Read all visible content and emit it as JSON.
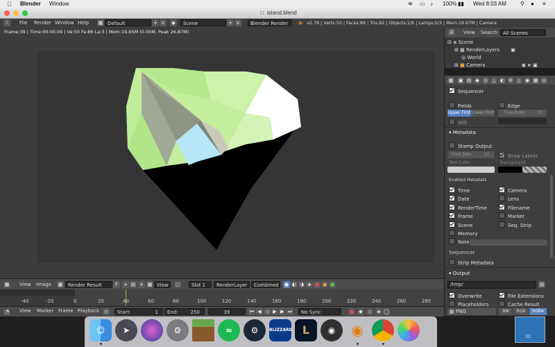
{
  "mac_menubar": {
    "app_name": "Blender",
    "window_menu": "Window",
    "battery": "100%",
    "datetime": "Wed 8:03 AM"
  },
  "window": {
    "title": "island.blend"
  },
  "blender_header": {
    "menus": [
      "File",
      "Render",
      "Window",
      "Help"
    ],
    "screen_layout": "Default",
    "scene": "Scene",
    "render_engine": "Blender Render",
    "stats": "v2.78 | Verts:50 | Faces:86 | Tris:92 | Objects:1/6 | Lamps:0/3 | Mem:19.67M | Camera"
  },
  "viewport": {
    "render_info": "Frame:39 | Time:00:00.09 | Ve:50 Fa:86 La:3 | Mem:19.65M (0.00M, Peak 26.87M)"
  },
  "image_editor_header": {
    "menus": [
      "View",
      "Image"
    ],
    "image_name": "Render Result",
    "image_fake_flag": "F",
    "view_menu": "View",
    "slot": "Slot 1",
    "render_layer": "RenderLayer",
    "pass": "Combined"
  },
  "timeline": {
    "ticks": [
      "-40",
      "-20",
      "0",
      "20",
      "40",
      "60",
      "80",
      "100",
      "120",
      "140",
      "160",
      "180",
      "200",
      "220",
      "240",
      "260"
    ],
    "last_tick": "280",
    "menus": [
      "View",
      "Marker",
      "Frame",
      "Playback"
    ],
    "start_label": "Start:",
    "start_value": "1",
    "end_label": "End:",
    "end_value": "250",
    "current_frame": "39",
    "sync_mode": "No Sync"
  },
  "outliner": {
    "header": {
      "view": "View",
      "search": "Search",
      "filter": "All Scenes"
    },
    "items": [
      "Scene",
      "RenderLayers",
      "World",
      "Camera"
    ]
  },
  "properties": {
    "sequencer_label": "Sequencer",
    "fields_label": "Fields",
    "edge_label": "Edge",
    "field_order": [
      "Upper First",
      "Lower First"
    ],
    "threshold_label": "Threshold:",
    "threshold_value": "10",
    "still_label": "Still",
    "metadata_header": "Metadata",
    "stamp_output_label": "Stamp Output",
    "font_size_label": "Font Size:",
    "font_size_value": "12",
    "draw_labels_label": "Draw Labels",
    "text_color_label": "Text Color:",
    "background_label": "Background:",
    "enabled_metadata_label": "Enabled Metadata",
    "metadata_left": [
      "Time",
      "Date",
      "RenderTime",
      "Frame",
      "Scene",
      "Memory",
      "Note"
    ],
    "metadata_left_checked": [
      true,
      true,
      true,
      true,
      true,
      false,
      false
    ],
    "metadata_right": [
      "Camera",
      "Lens",
      "Filename",
      "Marker",
      "Seq. Strip"
    ],
    "metadata_right_checked": [
      true,
      false,
      true,
      false,
      false
    ],
    "sequencer_sub_label": "Sequencer",
    "strip_metadata_label": "Strip Metadata",
    "output_header": "Output",
    "output_path": "/tmp/",
    "overwrite_label": "Overwrite",
    "file_extensions_label": "File Extensions",
    "placeholders_label": "Placeholders",
    "cache_result_label": "Cache Result",
    "file_format": "PNG",
    "color_modes": [
      "BW",
      "RGB",
      "RGBA"
    ]
  },
  "desktop": {
    "thumb_label": "3D"
  },
  "dock": {
    "apps": [
      "finder-icon",
      "launchpad-icon",
      "siri-icon",
      "system-preferences-icon",
      "minecraft-icon",
      "spotify-icon",
      "steam-icon",
      "blizzard-icon",
      "league-icon",
      "obs-icon",
      "blender-icon",
      "chrome-icon",
      "photos-icon"
    ],
    "blizzard_text": "BLIZZARD"
  },
  "colors": {
    "accent_blue": "#5680c2",
    "timeline_marker": "#7fbf3f",
    "island_green": "#c8f0a0"
  }
}
